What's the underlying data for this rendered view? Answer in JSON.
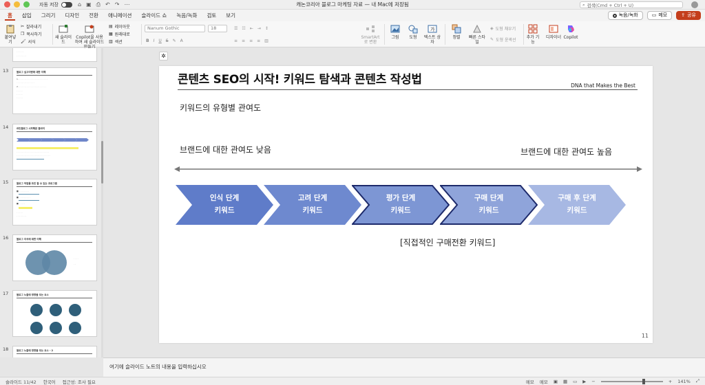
{
  "window": {
    "title": "캐논코리아 블로그 마케팅 자료 — 내 Mac에 저장됨",
    "autosave_label": "자동 저장",
    "search_placeholder": "검색(Cmd + Ctrl + U)"
  },
  "tabs": [
    "홈",
    "삽입",
    "그리기",
    "디자인",
    "전환",
    "애니메이션",
    "슬라이드 쇼",
    "녹음/녹화",
    "검토",
    "보기"
  ],
  "active_tab": "홈",
  "tab_actions": {
    "record": "녹음/녹화",
    "memo": "메모",
    "share": "공유"
  },
  "ribbon": {
    "paste": "붙여넣기",
    "cut": "잘라내기",
    "copy": "복사하기",
    "format": "서식",
    "new_slide": "새 슬라이드",
    "copilot_new": "Copilot을 사용하여 새 슬라이드 만들기",
    "layout": "레이아웃",
    "reset": "원래대로",
    "section": "섹션",
    "font_name": "Nanum Gothic",
    "font_size": "18",
    "smartart": "SmartArt로 변환",
    "picture": "그림",
    "shapes": "도형",
    "textbox": "텍스트 상자",
    "arrange": "정렬",
    "quick_styles": "빠른 스타일",
    "shape_fill": "도형 채우기",
    "shape_outline": "도형 윤곽선",
    "addins": "추가 기능",
    "designer": "디자이너",
    "copilot": "Copilot"
  },
  "thumbnails": [
    {
      "num": "13",
      "title": "블로그 실고이벤에 대한 이해"
    },
    {
      "num": "14",
      "title": "라인블로그 시작해본 블라이"
    },
    {
      "num": "15",
      "title": "블로그 작업물 프린 할 수 있는 프로그램"
    },
    {
      "num": "16",
      "title": "블로그 지식에 대한 이해"
    },
    {
      "num": "17",
      "title": "블로그 노출에 영향을 주는 요소"
    },
    {
      "num": "18",
      "title": "블로그 노출에 영향을 주는 요소 - 2"
    }
  ],
  "slide": {
    "title": "콘텐츠 SEO의 시작! 키워드 탐색과 콘텐츠 작성법",
    "tagline": "DNA that Makes the Best",
    "subtitle": "키워드의 유형별 관여도",
    "low_label": "브랜드에 대한 관여도 낮음",
    "high_label": "브랜드에 대한 관여도 높음",
    "stages": [
      {
        "line1": "인식 단계",
        "line2": "키워드",
        "fill": "#5f7cc9",
        "outlined": false
      },
      {
        "line1": "고려 단계",
        "line2": "키워드",
        "fill": "#6e89cf",
        "outlined": false
      },
      {
        "line1": "평가 단계",
        "line2": "키워드",
        "fill": "#7d96d4",
        "outlined": true
      },
      {
        "line1": "구매 단계",
        "line2": "키워드",
        "fill": "#8fa4da",
        "outlined": true
      },
      {
        "line1": "구매 후 단계",
        "line2": "키워드",
        "fill": "#a7b8e3",
        "outlined": false
      }
    ],
    "bracket_note": "[직접적인 구매전환 키워드]",
    "page_number": "11"
  },
  "notes_placeholder": "여기에 슬라이드 노트의 내용을 입력하십시오",
  "status": {
    "slide_info": "슬라이드 11/42",
    "language": "한국어",
    "accessibility": "접근성: 조사 필요",
    "notes": "메모",
    "comments": "메모",
    "zoom": "141%"
  },
  "colors": {
    "accent": "#c43e1c",
    "stage_outline": "#1d2a6b"
  }
}
